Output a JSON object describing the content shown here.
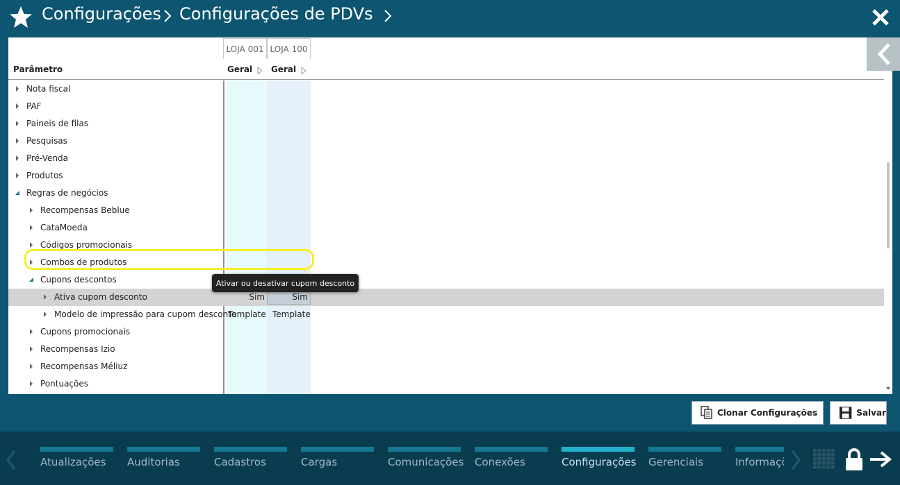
{
  "header": {
    "crumb1": "Configurações",
    "crumb2": "Configurações de PDVs"
  },
  "columns": {
    "store1": "LOJA 001",
    "store2": "LOJA 100",
    "param_header": "Parâmetro",
    "geral1": "Geral",
    "geral2": "Geral"
  },
  "tree": [
    {
      "label": "Nota fiscal",
      "level": 0,
      "expanded": false
    },
    {
      "label": "PAF",
      "level": 0,
      "expanded": false
    },
    {
      "label": "Paineis de filas",
      "level": 0,
      "expanded": false
    },
    {
      "label": "Pesquisas",
      "level": 0,
      "expanded": false
    },
    {
      "label": "Pré-Venda",
      "level": 0,
      "expanded": false
    },
    {
      "label": "Produtos",
      "level": 0,
      "expanded": false
    },
    {
      "label": "Regras de negócios",
      "level": 0,
      "expanded": true
    },
    {
      "label": "Recompensas Beblue",
      "level": 1,
      "expanded": false
    },
    {
      "label": "CataMoeda",
      "level": 1,
      "expanded": false
    },
    {
      "label": "Códigos promocionais",
      "level": 1,
      "expanded": false
    },
    {
      "label": "Combos de produtos",
      "level": 1,
      "expanded": false
    },
    {
      "label": "Cupons descontos",
      "level": 1,
      "expanded": true
    },
    {
      "label": "Ativa cupom desconto",
      "level": 2,
      "expanded": false,
      "selected": true,
      "v1": "Sim",
      "v2": "Sim"
    },
    {
      "label": "Modelo de impressão para cupom desconto",
      "level": 2,
      "expanded": false,
      "v1": "Template",
      "v2": "Template"
    },
    {
      "label": "Cupons promocionais",
      "level": 1,
      "expanded": false
    },
    {
      "label": "Recompensas Izio",
      "level": 1,
      "expanded": false
    },
    {
      "label": "Recompensas Méliuz",
      "level": 1,
      "expanded": false
    },
    {
      "label": "Pontuações",
      "level": 1,
      "expanded": false
    }
  ],
  "tooltip": "Ativar ou desativar cupom desconto",
  "buttons": {
    "clone": "Clonar Configurações",
    "save": "Salvar"
  },
  "nav": [
    {
      "label": "Atualizações",
      "active": false
    },
    {
      "label": "Auditorias",
      "active": false
    },
    {
      "label": "Cadastros",
      "active": false
    },
    {
      "label": "Cargas",
      "active": false
    },
    {
      "label": "Comunicações",
      "active": false
    },
    {
      "label": "Conexões",
      "active": false
    },
    {
      "label": "Configurações",
      "active": true
    },
    {
      "label": "Gerenciais",
      "active": false
    },
    {
      "label": "Informações",
      "active": false
    }
  ],
  "colors": {
    "header_bg": "#0d5570",
    "nav_bg": "#0a3c50",
    "nav_accent": "#157891",
    "nav_active": "#21b1cc",
    "highlight": "#f7ee2a"
  }
}
